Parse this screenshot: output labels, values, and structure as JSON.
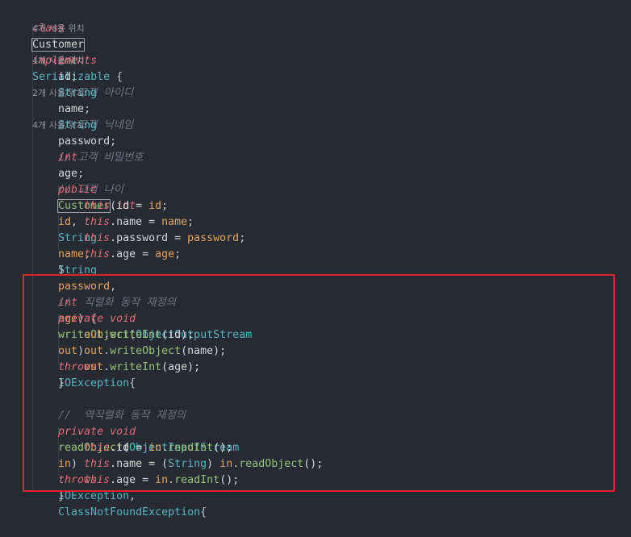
{
  "editor": {
    "class_decl": {
      "kw_class": "class",
      "name": "Customer",
      "kw_implements": "implements",
      "iface": "Serializable",
      "brace": " {"
    },
    "fields": [
      {
        "hint": "4개 사용 위치",
        "type": "int",
        "type_style": "kw",
        "name": "id",
        "comment": "// 고객 아이디"
      },
      {
        "hint": "4개 사용 위치",
        "type": "String",
        "type_style": "ty",
        "name": "name",
        "comment": "// 고객 닉네임"
      },
      {
        "hint": "2개 사용 위치",
        "type": "String",
        "type_style": "ty",
        "name": "password",
        "comment": "// 고객 비밀번호"
      },
      {
        "hint": "4개 사용 위치",
        "type": "int",
        "type_style": "kw",
        "name": "age",
        "comment": "// 고객 나이"
      }
    ],
    "constructor": {
      "modifier": "public",
      "name": "Customer",
      "params": [
        {
          "type": "int",
          "type_style": "kw",
          "name": "id"
        },
        {
          "type": "String",
          "type_style": "ty",
          "name": "name"
        },
        {
          "type": "String",
          "type_style": "ty",
          "name": "password"
        },
        {
          "type": "int",
          "type_style": "kw",
          "name": "age"
        }
      ],
      "body": [
        {
          "this": "this",
          "field": ".id = ",
          "value": "id"
        },
        {
          "this": "this",
          "field": ".name = ",
          "value": "name"
        },
        {
          "this": "this",
          "field": ".password = ",
          "value": "password"
        },
        {
          "this": "this",
          "field": ".age = ",
          "value": "age"
        }
      ],
      "close": "}"
    },
    "write_method": {
      "comment": "//  직렬화 동작 재정의",
      "modifiers": "private void",
      "name": "writeObject",
      "param_type": "ObjectOutputStream",
      "param_name": "out",
      "throws_kw": "throws",
      "exceptions": "IOException",
      "open": "{",
      "body": [
        {
          "obj": "out",
          "call": "writeInt",
          "arg": "(id);"
        },
        {
          "obj": "out",
          "call": "writeObject",
          "arg": "(name);"
        },
        {
          "obj": "out",
          "call": "writeInt",
          "arg": "(age);"
        }
      ],
      "close": "}"
    },
    "read_method": {
      "comment": "//  역직렬화 동작 재정의",
      "modifiers": "private void",
      "name": "readObject",
      "param_type": "ObjectInputStream",
      "param_name": "in",
      "throws_kw": "throws",
      "exception1": "IOException",
      "exception2": "ClassNotFoundException",
      "open": "{",
      "line1": {
        "this": "this",
        "field": ".id = ",
        "obj": "in",
        "call": "readInt",
        "rest": "();"
      },
      "line2": {
        "this": "this",
        "field": ".name = (",
        "cast": "String",
        "mid": ") ",
        "obj": "in",
        "call": "readObject",
        "rest": "();"
      },
      "line3": {
        "this": "this",
        "field": ".age = ",
        "obj": "in",
        "call": "readInt",
        "rest": "();"
      },
      "close": "}"
    }
  },
  "colors": {
    "background": "#262a33",
    "keyword": "#e06c75",
    "type": "#56b6c2",
    "method": "#98c379",
    "parameter": "#e5a45f",
    "comment": "#6d7380",
    "highlight_border": "#e0242a"
  }
}
